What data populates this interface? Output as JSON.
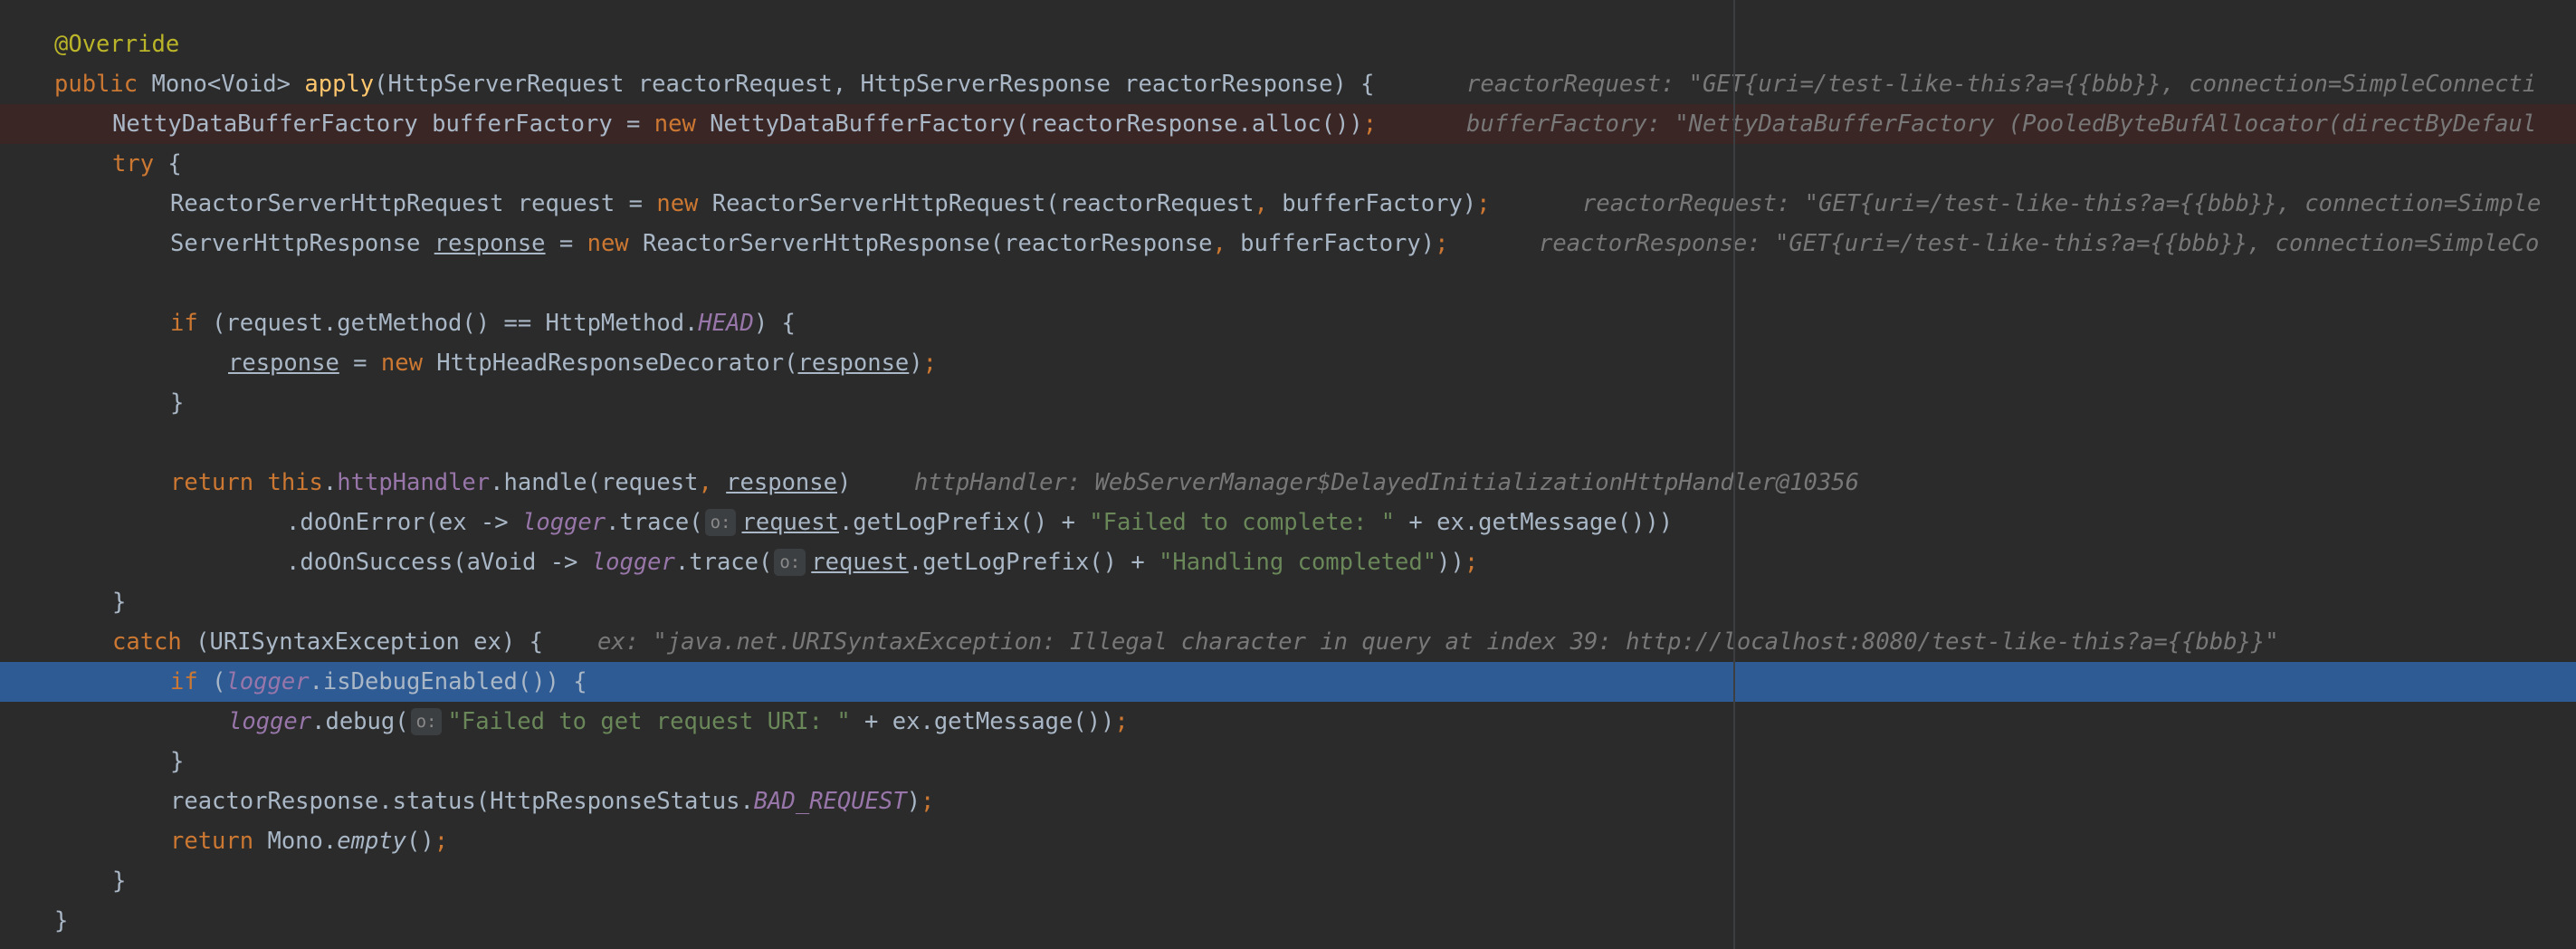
{
  "editor": {
    "lines": [
      {
        "tokens": [
          "@Override"
        ]
      },
      {
        "tokens": [
          "public",
          " Mono<Void> ",
          "apply",
          "(HttpServerRequest reactorRequest, HttpServerResponse reactorResponse) {"
        ],
        "hint": "reactorRequest: \"GET{uri=/test-like-this?a={{bbb}}, connection=SimpleConnecti"
      },
      {
        "tokens": [
          "NettyDataBufferFactory bufferFactory = ",
          "new",
          " NettyDataBufferFactory(reactorResponse.alloc())",
          ";"
        ],
        "hint": "bufferFactory: \"NettyDataBufferFactory (PooledByteBufAllocator(directByDefaul"
      },
      {
        "tokens": [
          "try",
          " {"
        ]
      },
      {
        "tokens": [
          "ReactorServerHttpRequest request = ",
          "new",
          " ReactorServerHttpRequest(reactorRequest",
          ",",
          " bufferFactory)",
          ";"
        ],
        "hint": "reactorRequest: \"GET{uri=/test-like-this?a={{bbb}}, connection=Simple"
      },
      {
        "tokens": [
          "ServerHttpResponse ",
          "response",
          " = ",
          "new",
          " ReactorServerHttpResponse(reactorResponse",
          ",",
          " bufferFactory)",
          ";"
        ],
        "hint": "reactorResponse: \"GET{uri=/test-like-this?a={{bbb}}, connection=SimpleCo"
      },
      {
        "tokens": [
          "if",
          " (request.getMethod() == HttpMethod.",
          "HEAD",
          ") {"
        ]
      },
      {
        "tokens": [
          "response",
          " = ",
          "new",
          " HttpHeadResponseDecorator(",
          "response",
          ")",
          ";"
        ]
      },
      {
        "tokens": [
          "}"
        ]
      },
      {
        "tokens": [
          "return",
          " ",
          "this",
          ".",
          "httpHandler",
          ".handle(request",
          ",",
          " ",
          "response",
          ")"
        ],
        "hint": "httpHandler: WebServerManager$DelayedInitializationHttpHandler@10356"
      },
      {
        "tokens": [
          ".doOnError(ex -> ",
          "logger",
          ".trace(",
          "o:",
          "request",
          ".getLogPrefix() + ",
          "\"Failed to complete: \"",
          " + ex.getMessage()))"
        ]
      },
      {
        "tokens": [
          ".doOnSuccess(aVoid -> ",
          "logger",
          ".trace(",
          "o:",
          "request",
          ".getLogPrefix() + ",
          "\"Handling completed\"",
          "))",
          ";"
        ]
      },
      {
        "tokens": [
          "}"
        ]
      },
      {
        "tokens": [
          "catch",
          " (URISyntaxException ex) {"
        ],
        "hint": "ex: \"java.net.URISyntaxException: Illegal character in query at index 39: http://localhost:8080/test-like-this?a={{bbb}}\""
      },
      {
        "tokens": [
          "if",
          " (",
          "logger",
          ".isDebugEnabled()) {"
        ]
      },
      {
        "tokens": [
          "logger",
          ".debug(",
          "o:",
          "\"Failed to get request URI: \"",
          " + ex.getMessage())",
          ";"
        ]
      },
      {
        "tokens": [
          "}"
        ]
      },
      {
        "tokens": [
          "reactorResponse.status(HttpResponseStatus.",
          "BAD_REQUEST",
          ")",
          ";"
        ]
      },
      {
        "tokens": [
          "return",
          " Mono.",
          "empty",
          "()",
          ";"
        ]
      },
      {
        "tokens": [
          "}"
        ]
      },
      {
        "tokens": [
          "}"
        ]
      }
    ]
  },
  "colors": {
    "background": "#2b2b2b",
    "text": "#a9b7c6",
    "keyword": "#cc7832",
    "annotation": "#bbb529",
    "method_declaration": "#ffc66d",
    "field": "#9876aa",
    "string": "#6a8759",
    "inline_hint": "#787878",
    "execution_line": "#2f5b94",
    "breakpoint_line": "#3b2626"
  }
}
